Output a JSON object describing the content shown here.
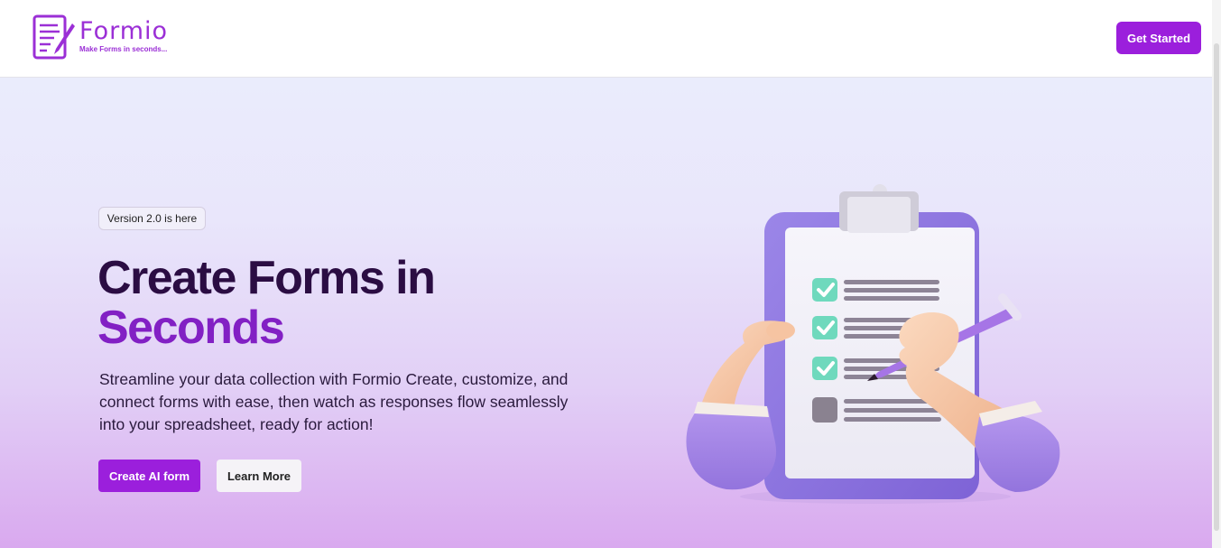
{
  "brand": {
    "name": "Formio",
    "tagline": "Make Forms in seconds...",
    "accent_color": "#9b1fdc",
    "logo_icon": "form-pen-icon"
  },
  "nav": {
    "cta_label": "Get Started"
  },
  "hero": {
    "badge": "Version 2.0 is here",
    "title_line1": "Create Forms in",
    "title_line2": "Seconds",
    "description": "Streamline your data collection with Formio Create, customize, and connect forms with ease, then watch as responses flow seamlessly into your spreadsheet, ready for action!",
    "primary_button": "Create AI form",
    "secondary_button": "Learn More",
    "illustration": "clipboard-checklist-icon"
  }
}
